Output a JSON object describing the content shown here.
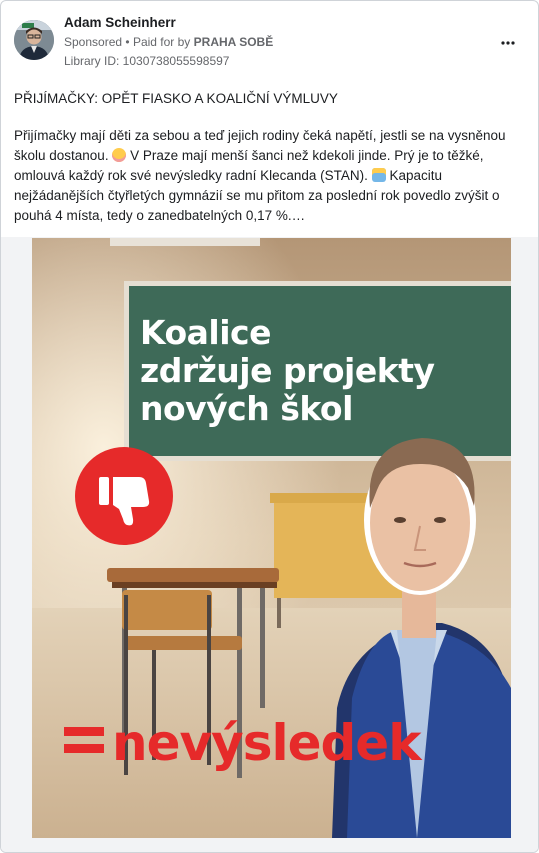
{
  "post": {
    "author": "Adam Scheinherr",
    "sponsored": "Sponsored",
    "separator": "•",
    "paid_prefix": "Paid for by",
    "paid_by": "PRAHA SOBĚ",
    "library_id": "Library ID: 1030738055598597",
    "more_icon": "more-options-icon",
    "headline": "PŘIJÍMAČKY: OPĚT FIASKO A KOALIČNÍ VÝMLUVY",
    "body_part1": "Přijímačky mají děti za sebou a teď jejich rodiny čeká napětí, jestli se na vysněnou školu dostanou.",
    "body_part2": "V Praze mají menší šanci než kdekoli jinde. Prý je to těžké, omlouvá každý rok své nevýsledky radní Klecanda (STAN).",
    "body_part3": "Kapacitu nejžádanějších čtyřletých gymnázií se mu přitom za poslední rok povedlo zvýšit o pouhá 4 místa, tedy o zanedbatelných 0,17 %.…"
  },
  "ad_image": {
    "headline_line1": "Koalice",
    "headline_line2": "zdržuje projekty",
    "headline_line3": "nových škol",
    "thumb_icon": "thumbs-down-icon",
    "brand": "nevýsledek",
    "brand_color": "#e62a2a",
    "board_color": "#3e6a58"
  }
}
